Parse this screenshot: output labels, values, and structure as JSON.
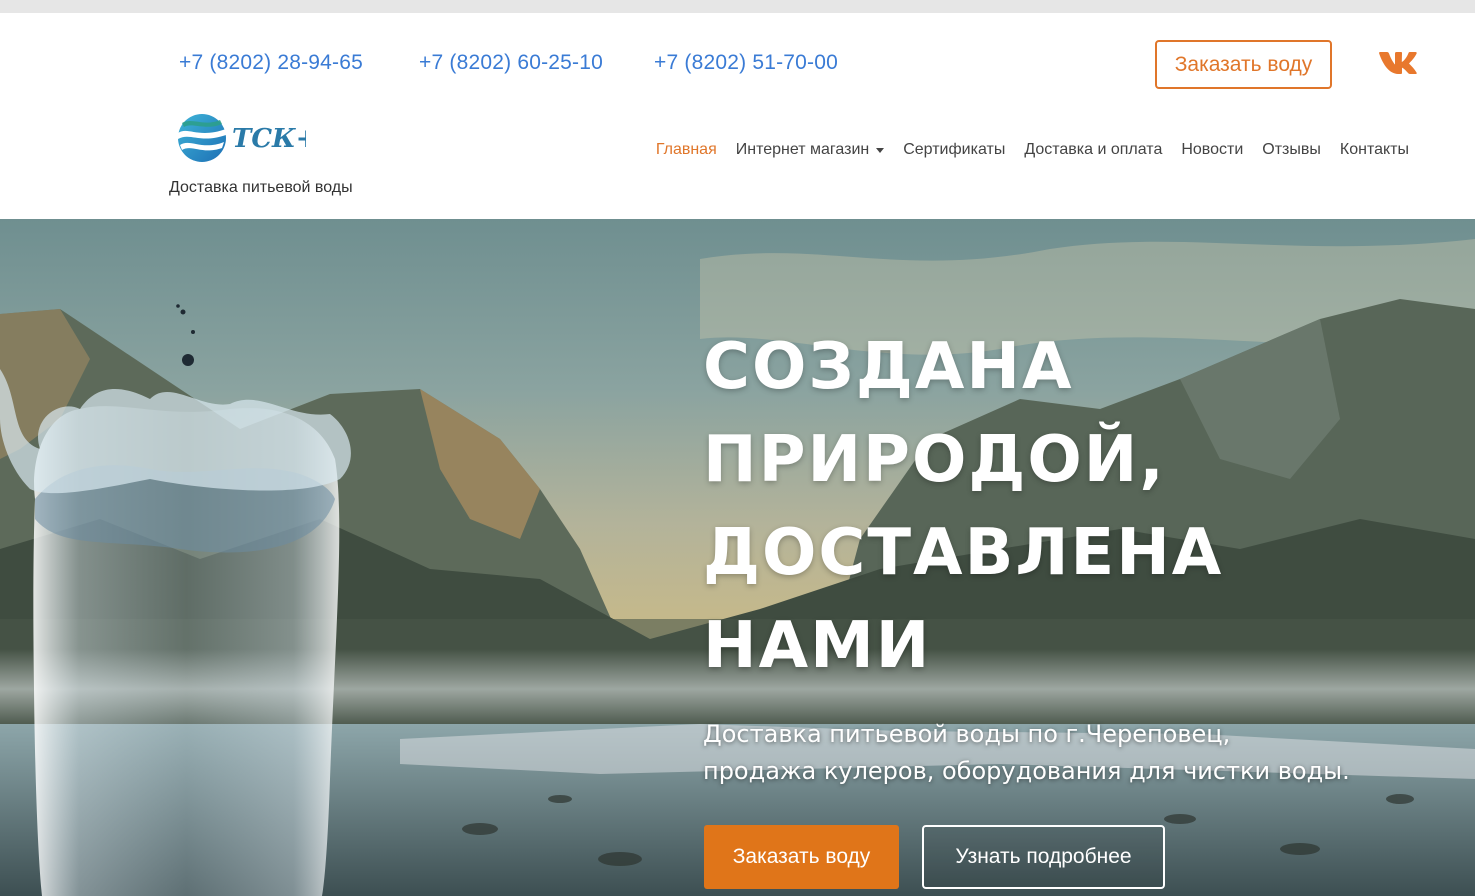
{
  "header": {
    "phones": [
      "+7 (8202) 28-94-65",
      "+7 (8202) 60-25-10",
      "+7 (8202) 51-70-00"
    ],
    "order_button": "Заказать воду",
    "vk_icon": "vk-icon",
    "tagline": "Доставка питьевой воды"
  },
  "nav": {
    "items": [
      {
        "label": "Главная",
        "active": true
      },
      {
        "label": "Интернет магазин",
        "dropdown": true
      },
      {
        "label": "Сертификаты"
      },
      {
        "label": "Доставка и оплата"
      },
      {
        "label": "Новости"
      },
      {
        "label": "Отзывы"
      },
      {
        "label": "Контакты"
      }
    ]
  },
  "hero": {
    "headline_lines": [
      "СОЗДАНА",
      "ПРИРОДОЙ,",
      "ДОСТАВЛЕНА",
      "НАМИ"
    ],
    "subtitle_lines": [
      "Доставка питьевой воды по г.Череповец,",
      "продажа кулеров, оборудования для чистки воды."
    ],
    "order_button": "Заказать воду",
    "more_button": "Узнать подробнее"
  },
  "colors": {
    "accent": "#e0762a",
    "link": "#3a7bd5",
    "text": "#444444"
  }
}
